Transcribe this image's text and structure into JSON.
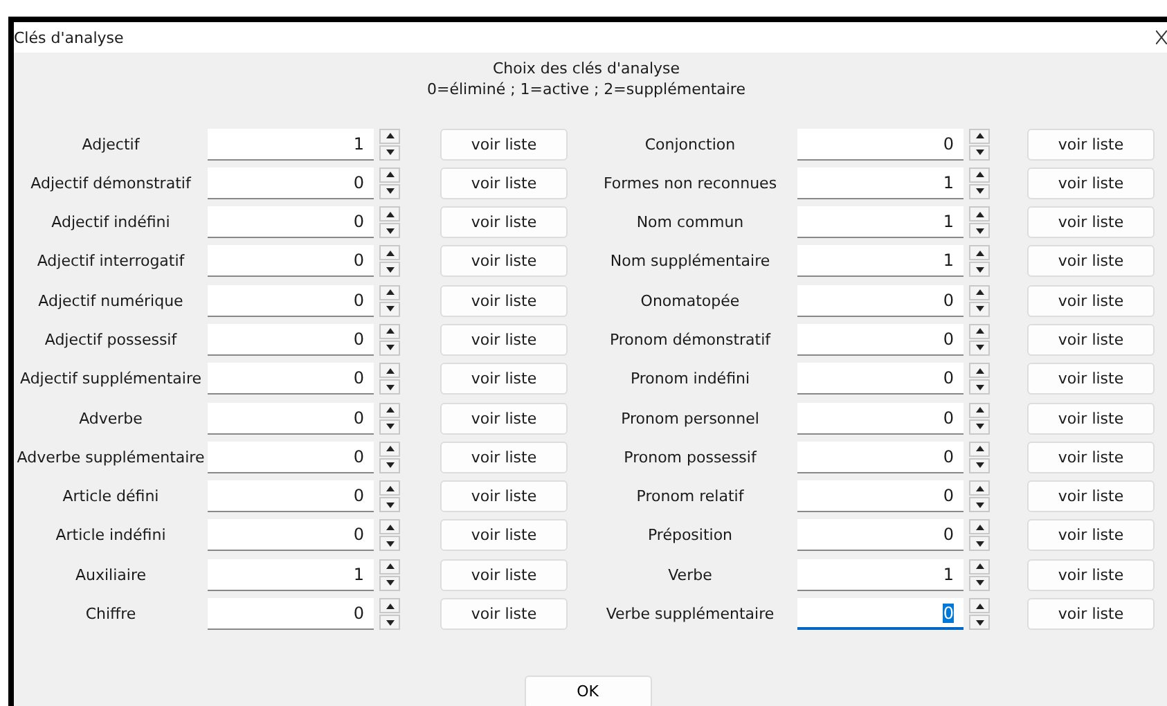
{
  "window": {
    "title": "Clés d'analyse"
  },
  "heading": [
    "Choix des clés d'analyse",
    "0=éliminé ; 1=active ; 2=supplémentaire"
  ],
  "columns": [
    [
      {
        "label": "Adjectif",
        "value": "1",
        "button": "voir liste",
        "focused": false
      },
      {
        "label": "Adjectif démonstratif",
        "value": "0",
        "button": "voir liste",
        "focused": false
      },
      {
        "label": "Adjectif indéfini",
        "value": "0",
        "button": "voir liste",
        "focused": false
      },
      {
        "label": "Adjectif interrogatif",
        "value": "0",
        "button": "voir liste",
        "focused": false
      },
      {
        "label": "Adjectif numérique",
        "value": "0",
        "button": "voir liste",
        "focused": false
      },
      {
        "label": "Adjectif possessif",
        "value": "0",
        "button": "voir liste",
        "focused": false
      },
      {
        "label": "Adjectif supplémentaire",
        "value": "0",
        "button": "voir liste",
        "focused": false
      },
      {
        "label": "Adverbe",
        "value": "0",
        "button": "voir liste",
        "focused": false
      },
      {
        "label": "Adverbe supplémentaire",
        "value": "0",
        "button": "voir liste",
        "focused": false
      },
      {
        "label": "Article défini",
        "value": "0",
        "button": "voir liste",
        "focused": false
      },
      {
        "label": "Article indéfini",
        "value": "0",
        "button": "voir liste",
        "focused": false
      },
      {
        "label": "Auxiliaire",
        "value": "1",
        "button": "voir liste",
        "focused": false
      },
      {
        "label": "Chiffre",
        "value": "0",
        "button": "voir liste",
        "focused": false
      }
    ],
    [
      {
        "label": "Conjonction",
        "value": "0",
        "button": "voir liste",
        "focused": false
      },
      {
        "label": "Formes non reconnues",
        "value": "1",
        "button": "voir liste",
        "focused": false
      },
      {
        "label": "Nom commun",
        "value": "1",
        "button": "voir liste",
        "focused": false
      },
      {
        "label": "Nom supplémentaire",
        "value": "1",
        "button": "voir liste",
        "focused": false
      },
      {
        "label": "Onomatopée",
        "value": "0",
        "button": "voir liste",
        "focused": false
      },
      {
        "label": "Pronom démonstratif",
        "value": "0",
        "button": "voir liste",
        "focused": false
      },
      {
        "label": "Pronom indéfini",
        "value": "0",
        "button": "voir liste",
        "focused": false
      },
      {
        "label": "Pronom personnel",
        "value": "0",
        "button": "voir liste",
        "focused": false
      },
      {
        "label": "Pronom possessif",
        "value": "0",
        "button": "voir liste",
        "focused": false
      },
      {
        "label": "Pronom relatif",
        "value": "0",
        "button": "voir liste",
        "focused": false
      },
      {
        "label": "Préposition",
        "value": "0",
        "button": "voir liste",
        "focused": false
      },
      {
        "label": "Verbe",
        "value": "1",
        "button": "voir liste",
        "focused": false
      },
      {
        "label": "Verbe supplémentaire",
        "value": "0",
        "button": "voir liste",
        "focused": true
      }
    ]
  ],
  "ok_button": "OK"
}
